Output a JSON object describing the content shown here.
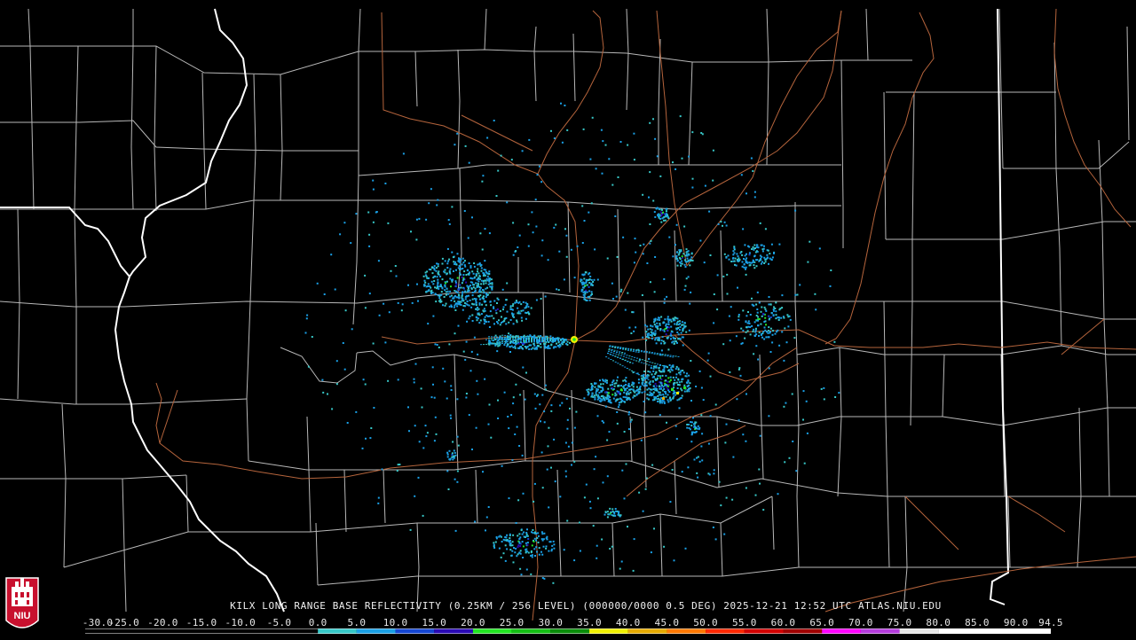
{
  "product": {
    "caption": "KILX LONG RANGE BASE REFLECTIVITY (0.25KM / 256 LEVEL) (000000/0000 0.5 DEG) 2025-12-21 12:52 UTC  ATLAS.NIU.EDU",
    "logo_text": "NIU"
  },
  "colorbar": {
    "labels": [
      "-30.0",
      "-25.0",
      "-20.0",
      "-15.0",
      "-10.0",
      "-5.0",
      "0.0",
      "5.0",
      "10.0",
      "15.0",
      "20.0",
      "25.0",
      "30.0",
      "35.0",
      "40.0",
      "45.0",
      "50.0",
      "55.0",
      "60.0",
      "65.0",
      "70.0",
      "75.0",
      "80.0",
      "85.0",
      "90.0",
      "94.5"
    ],
    "segments": [
      {
        "from": -30,
        "to": 0,
        "color": "#000000"
      },
      {
        "from": 0,
        "to": 5,
        "color": "#37c8c8"
      },
      {
        "from": 5,
        "to": 10,
        "color": "#1aa0e6"
      },
      {
        "from": 10,
        "to": 15,
        "color": "#1446d2"
      },
      {
        "from": 15,
        "to": 20,
        "color": "#2a0ab4"
      },
      {
        "from": 20,
        "to": 25,
        "color": "#22e622"
      },
      {
        "from": 25,
        "to": 30,
        "color": "#14be14"
      },
      {
        "from": 30,
        "to": 35,
        "color": "#0a8c0a"
      },
      {
        "from": 35,
        "to": 40,
        "color": "#f0f000"
      },
      {
        "from": 40,
        "to": 45,
        "color": "#e6aa00"
      },
      {
        "from": 45,
        "to": 50,
        "color": "#ff7800"
      },
      {
        "from": 50,
        "to": 55,
        "color": "#ff2800"
      },
      {
        "from": 55,
        "to": 60,
        "color": "#d20000"
      },
      {
        "from": 60,
        "to": 65,
        "color": "#a00000"
      },
      {
        "from": 65,
        "to": 70,
        "color": "#ff00ff"
      },
      {
        "from": 70,
        "to": 75,
        "color": "#b43cdc"
      },
      {
        "from": 75,
        "to": 80,
        "color": "#e6e6e6"
      },
      {
        "from": 80,
        "to": 94.5,
        "color": "#ffffff"
      }
    ]
  },
  "colors": {
    "background": "#000000",
    "county_lines": "#b8b8b8",
    "state_lines": "#ffffff",
    "highways": "#b5643c"
  }
}
